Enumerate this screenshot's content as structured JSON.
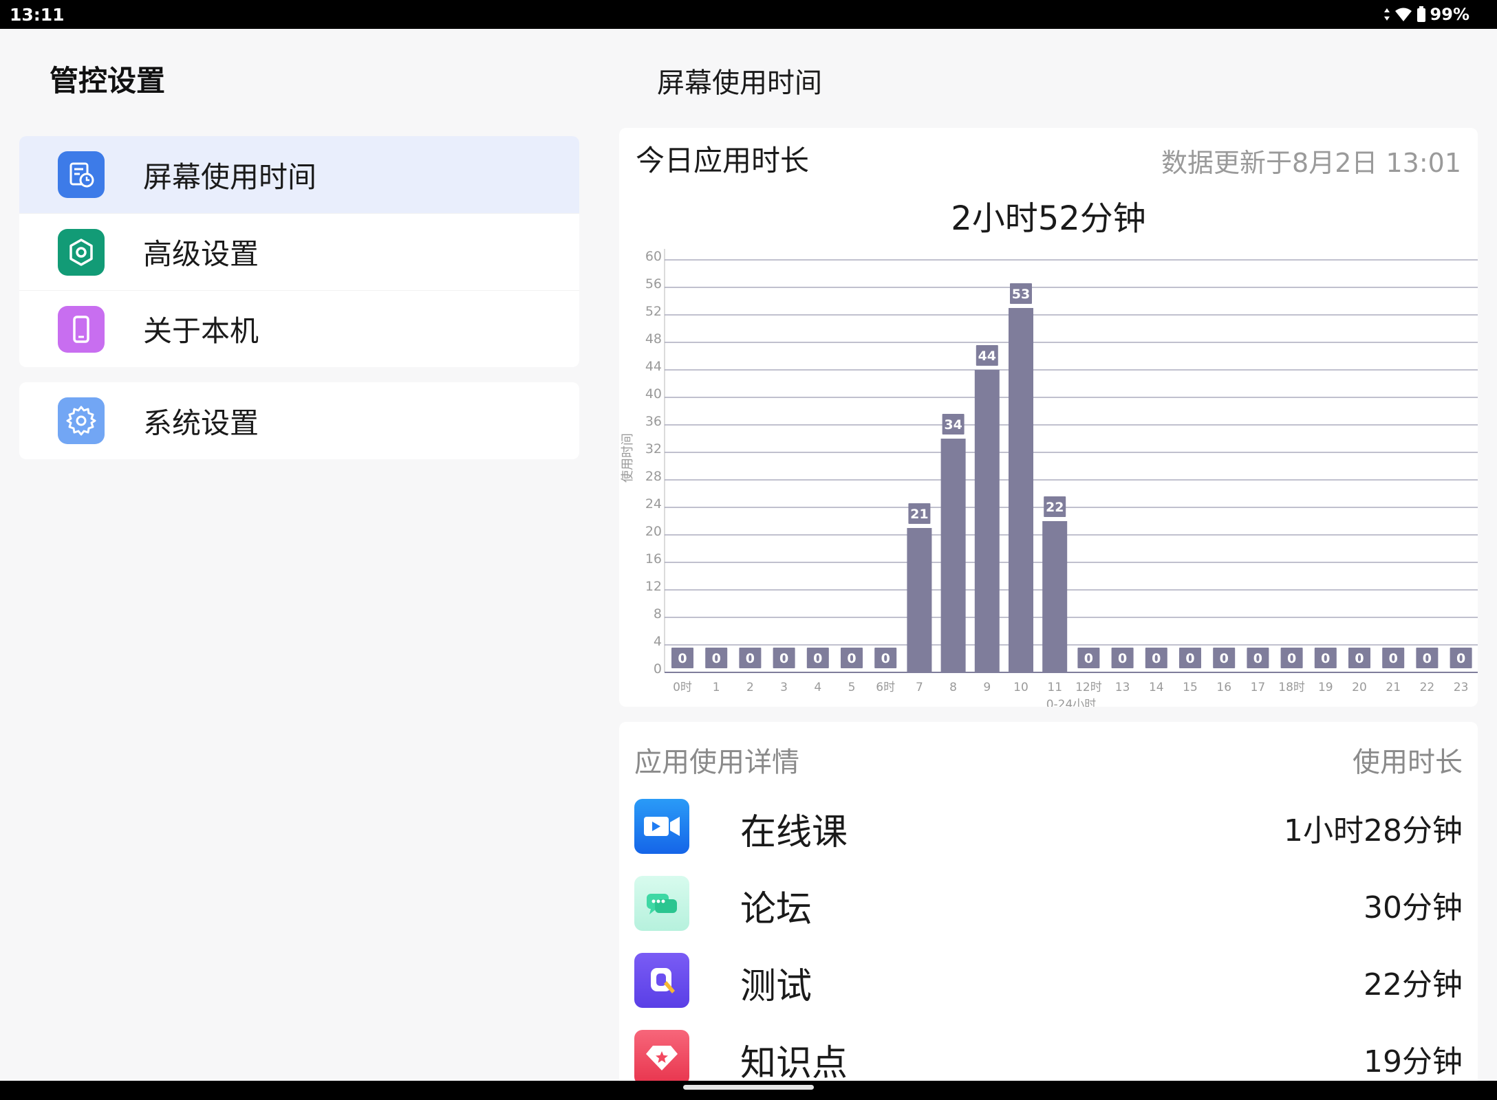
{
  "status_bar": {
    "time": "13:11",
    "battery": "99%"
  },
  "sidebar": {
    "title": "管控设置",
    "items": [
      {
        "label": "屏幕使用时间",
        "icon": "screen-time-icon",
        "color": "#3d7be8",
        "active": true
      },
      {
        "label": "高级设置",
        "icon": "advanced-settings-icon",
        "color": "#129b76",
        "active": false
      },
      {
        "label": "关于本机",
        "icon": "about-device-icon",
        "color": "#c86ef0",
        "active": false
      },
      {
        "label": "系统设置",
        "icon": "system-settings-icon",
        "color": "#72a6f4",
        "active": false
      }
    ]
  },
  "main": {
    "title": "屏幕使用时间",
    "chart_card": {
      "heading": "今日应用时长",
      "updated": "数据更新于8月2日 13:01",
      "total": "2小时52分钟"
    },
    "app_list": {
      "header_left": "应用使用详情",
      "header_right": "使用时长",
      "apps": [
        {
          "name": "在线课",
          "time": "1小时28分钟",
          "icon": "video-camera-icon",
          "color": "#1f7cf2"
        },
        {
          "name": "论坛",
          "time": "30分钟",
          "icon": "chat-bubbles-icon",
          "color": "#2fd0a0"
        },
        {
          "name": "测试",
          "time": "22分钟",
          "icon": "quiz-icon",
          "color": "#6b4ff0"
        },
        {
          "name": "知识点",
          "time": "19分钟",
          "icon": "diamond-icon",
          "color": "#f2485f"
        }
      ]
    }
  },
  "chart_data": {
    "type": "bar",
    "categories": [
      "0时",
      "1",
      "2",
      "3",
      "4",
      "5",
      "6时",
      "7",
      "8",
      "9",
      "10",
      "11",
      "12时",
      "13",
      "14",
      "15",
      "16",
      "17",
      "18时",
      "19",
      "20",
      "21",
      "22",
      "23"
    ],
    "values": [
      0,
      0,
      0,
      0,
      0,
      0,
      0,
      21,
      34,
      44,
      53,
      22,
      0,
      0,
      0,
      0,
      0,
      0,
      0,
      0,
      0,
      0,
      0,
      0
    ],
    "xlabel": "0-24小时",
    "ylabel": "使用时间",
    "ylim": [
      0,
      60
    ],
    "yticks": [
      0,
      4,
      8,
      12,
      16,
      20,
      24,
      28,
      32,
      36,
      40,
      44,
      48,
      52,
      56,
      60
    ],
    "grid": true,
    "bar_color": "#7f7d9b",
    "label_color": "#7f7d9b"
  }
}
